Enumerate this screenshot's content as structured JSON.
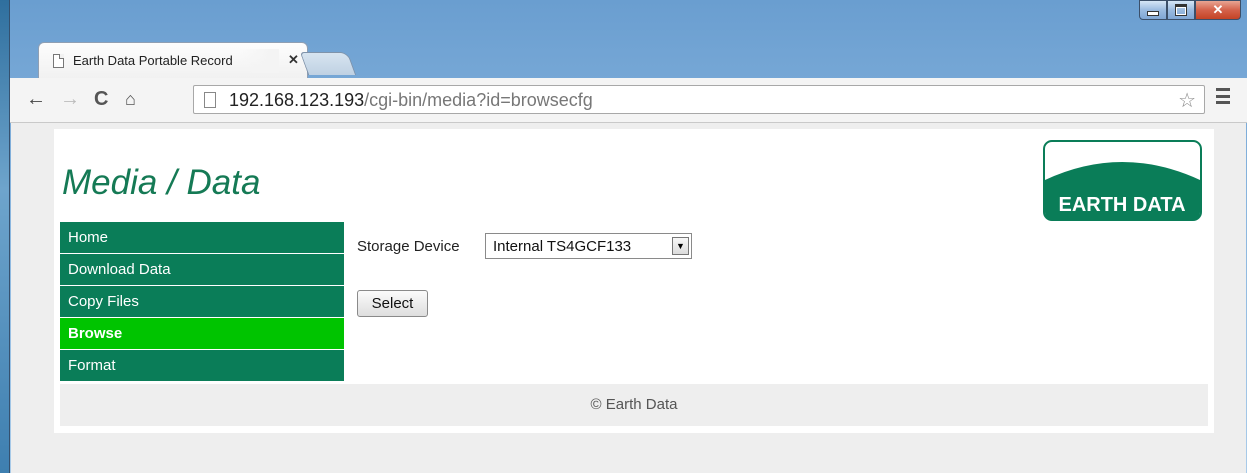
{
  "browser": {
    "tab_title": "Earth Data Portable Record",
    "url_host": "192.168.123.193",
    "url_path": "/cgi-bin/media?id=browsecfg"
  },
  "page": {
    "title": "Media / Data",
    "logo_text": "EARTH DATA",
    "nav": [
      {
        "label": "Home"
      },
      {
        "label": "Download Data"
      },
      {
        "label": "Copy Files"
      },
      {
        "label": "Browse",
        "active": true
      },
      {
        "label": "Format"
      }
    ],
    "storage_label": "Storage Device",
    "storage_value": "Internal TS4GCF133",
    "select_button": "Select",
    "footer": "© Earth Data"
  },
  "colors": {
    "brand_green": "#0a7d58",
    "active_green": "#00c400",
    "title_green": "#157a55"
  }
}
